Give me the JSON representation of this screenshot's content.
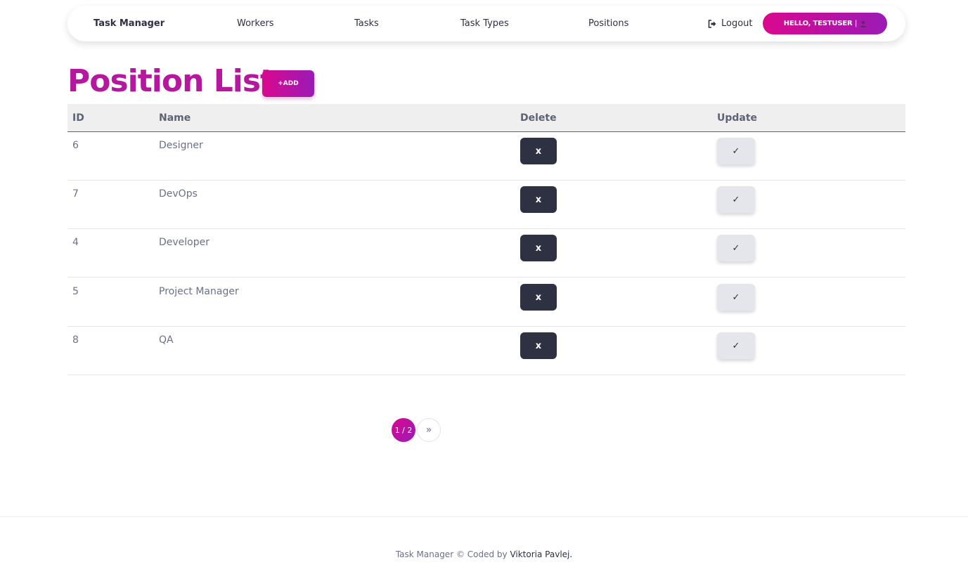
{
  "nav": {
    "brand": "Task Manager",
    "items": [
      "Workers",
      "Tasks",
      "Task Types",
      "Positions"
    ],
    "logout_label": "Logout",
    "logout_icon": "sign-out-icon",
    "greeting": "HELLO, TESTUSER |",
    "user_icon": "user-icon"
  },
  "page": {
    "title": "Position List",
    "add_label": "+ADD"
  },
  "table": {
    "columns": [
      "ID",
      "Name",
      "Delete",
      "Update"
    ],
    "delete_label": "x",
    "update_label": "✓",
    "rows": [
      {
        "id": "6",
        "name": "Designer"
      },
      {
        "id": "7",
        "name": "DevOps"
      },
      {
        "id": "4",
        "name": "Developer"
      },
      {
        "id": "5",
        "name": "Project Manager"
      },
      {
        "id": "8",
        "name": "QA"
      }
    ]
  },
  "pagination": {
    "current": "1 / 2",
    "next_label": "»"
  },
  "footer": {
    "text": "Task Manager © Coded by",
    "author": "Viktoria Pavlej."
  },
  "colors": {
    "accent_start": "#d9088f",
    "accent_end": "#9a1bb6",
    "title": "#b5179e",
    "dark": "#2d3142"
  }
}
